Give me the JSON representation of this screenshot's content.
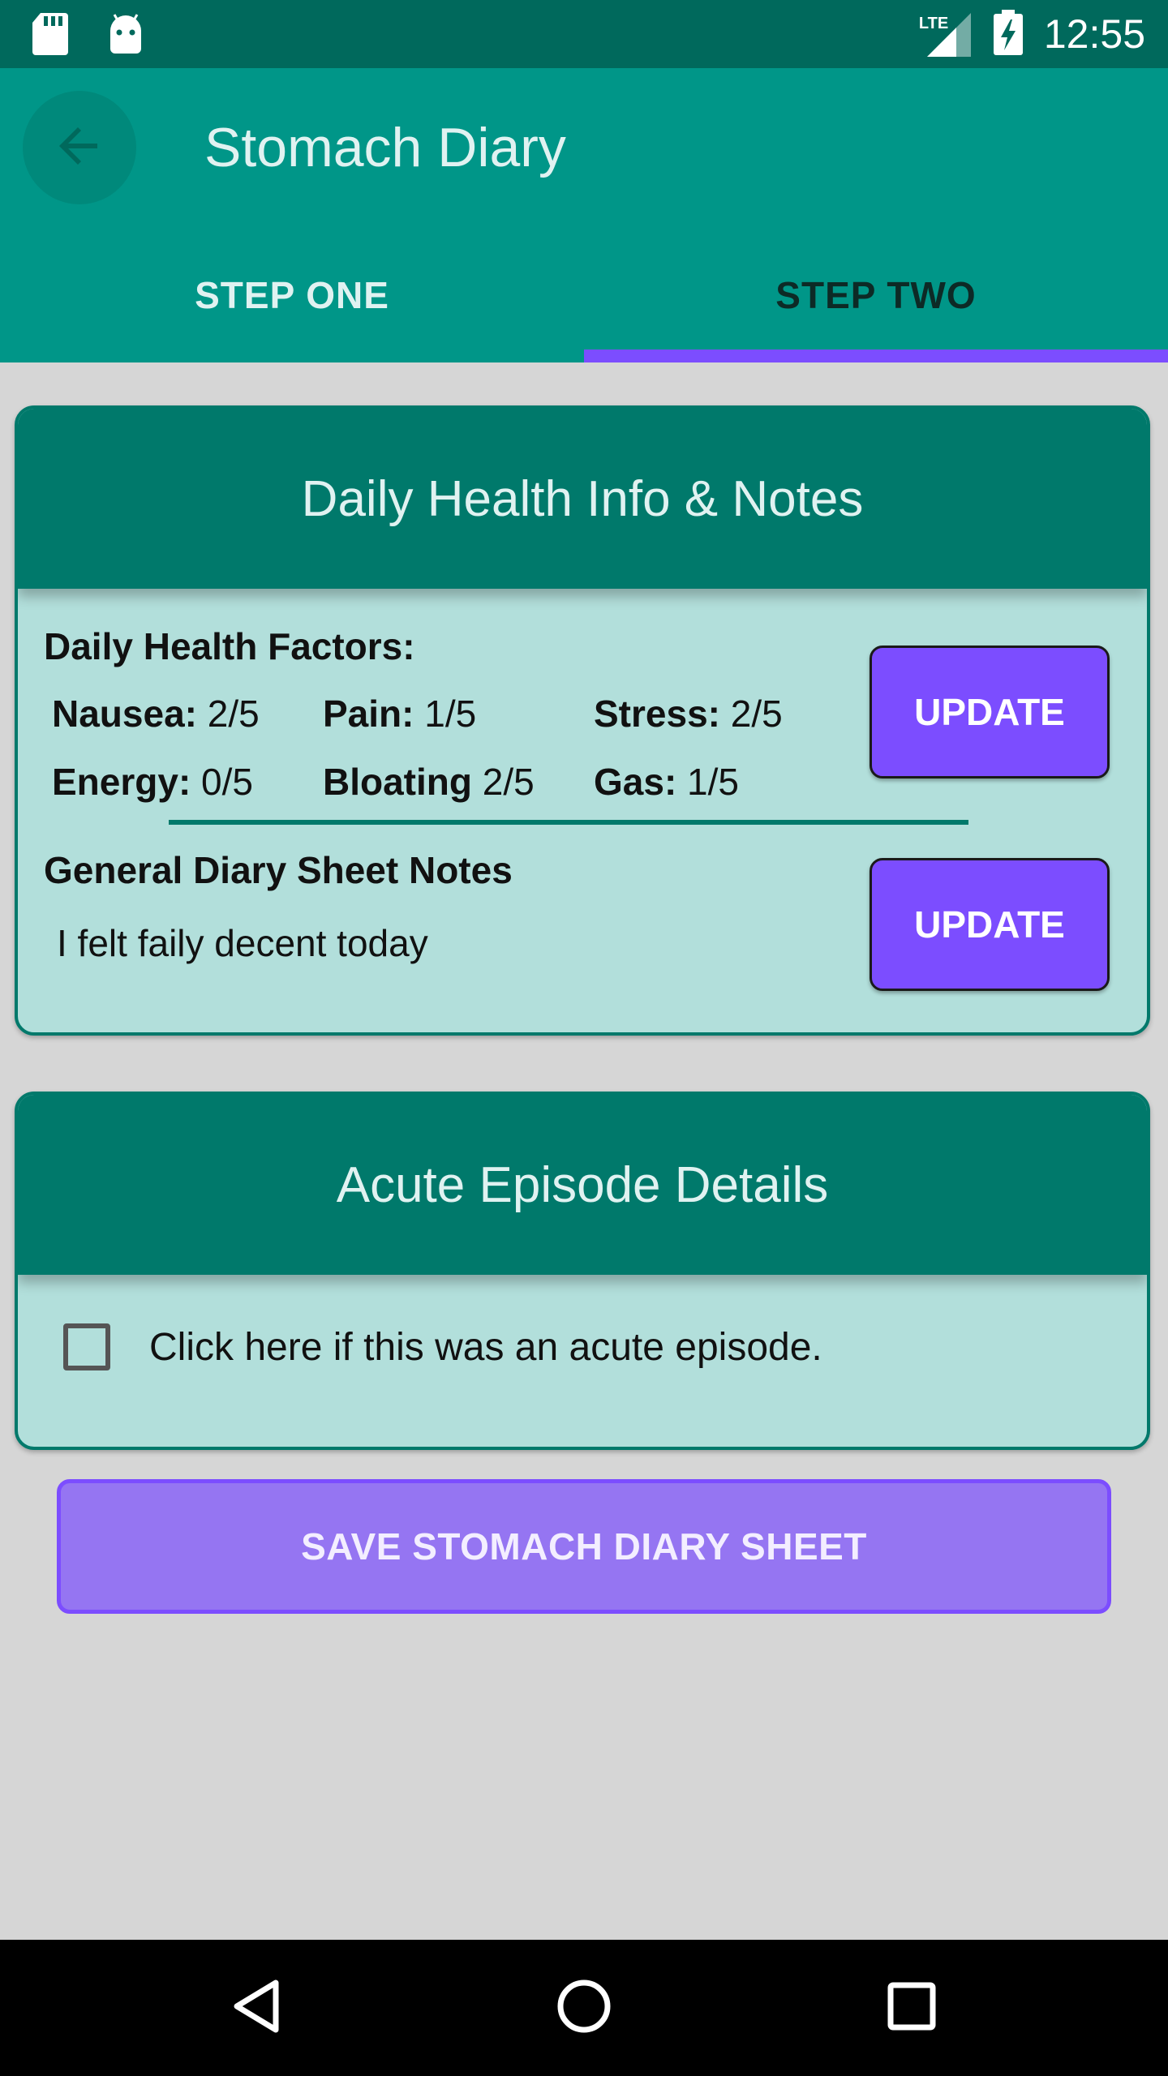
{
  "status_bar": {
    "time": "12:55",
    "network": "LTE",
    "icons": [
      "sd-card-icon",
      "android-icon",
      "signal-icon",
      "battery-charging-icon"
    ]
  },
  "app_bar": {
    "title": "Stomach Diary",
    "back_icon": "arrow-back-icon",
    "tabs": [
      {
        "label": "STEP ONE",
        "selected": false
      },
      {
        "label": "STEP TWO",
        "selected": true
      }
    ]
  },
  "health_card": {
    "title": "Daily Health Info & Notes",
    "factors_heading": "Daily Health Factors:",
    "factors": [
      {
        "label": "Nausea:",
        "value": "2/5"
      },
      {
        "label": "Pain:",
        "value": "1/5"
      },
      {
        "label": "Stress:",
        "value": "2/5"
      },
      {
        "label": "Energy:",
        "value": "0/5"
      },
      {
        "label": "Bloating",
        "value": "2/5"
      },
      {
        "label": "Gas:",
        "value": "1/5"
      }
    ],
    "factors_update_label": "UPDATE",
    "notes_heading": "General Diary Sheet Notes",
    "notes_text": "I felt faily decent today",
    "notes_update_label": "UPDATE"
  },
  "acute_card": {
    "title": "Acute Episode Details",
    "checkbox_label": "Click here if this was an acute episode.",
    "checked": false
  },
  "save_button_label": "SAVE STOMACH DIARY SHEET",
  "colors": {
    "primary": "#009688",
    "primary_dark": "#00695c",
    "card_header": "#00796b",
    "card_body": "#b2dfdb",
    "accent": "#7c4dff"
  },
  "nav_bar": {
    "icons": [
      "back-triangle-icon",
      "home-circle-icon",
      "recents-square-icon"
    ]
  }
}
